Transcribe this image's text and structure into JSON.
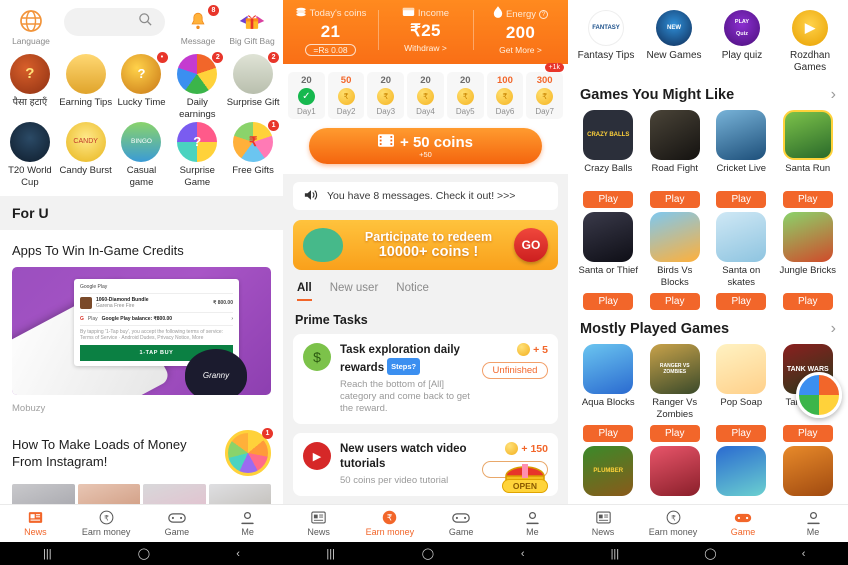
{
  "panel1": {
    "topbar": {
      "language_label": "Language",
      "language_icon": "globe-icon",
      "search_placeholder": "",
      "search_icon": "search-icon",
      "message_label": "Message",
      "message_icon": "bell-icon",
      "message_badge": "8",
      "gift_label": "Big Gift Bag",
      "gift_icon": "gift-box-icon"
    },
    "grid": [
      {
        "label": "पैसा हटाएँ",
        "icon": "money-bag-icon",
        "badge": ""
      },
      {
        "label": "Earning Tips",
        "icon": "coin-stack-icon",
        "badge": ""
      },
      {
        "label": "Lucky Time",
        "icon": "mystery-gift-icon",
        "badge": "•"
      },
      {
        "label": "Daily earnings",
        "icon": "spin-wheel-icon",
        "badge": "2"
      },
      {
        "label": "Surprise Gift",
        "icon": "cash-pile-icon",
        "badge": "2"
      },
      {
        "label": "T20 World Cup",
        "icon": "cricket-icon",
        "badge": ""
      },
      {
        "label": "Candy Burst",
        "icon": "candy-icon",
        "badge": ""
      },
      {
        "label": "Casual game",
        "icon": "bingo-icon",
        "badge": ""
      },
      {
        "label": "Surprise Game",
        "icon": "question-wheel-icon",
        "badge": ""
      },
      {
        "label": "Free Gifts",
        "icon": "rupee-wheel-icon",
        "badge": "1"
      }
    ],
    "section_title": "For U",
    "article1": {
      "title": "Apps To Win In-Game Credits",
      "source": "Mobuzy",
      "card": {
        "store": "Google Play",
        "item_title": "1060-Diamond Bundle",
        "item_sub": "Garena Free Fire",
        "item_price": "₹ 800.00",
        "balance_label": "Google Play balance: ₹800.00",
        "terms": "By tapping '1-Tap buy', you accept the following terms of service: Terms of Service · Android Dudes, Privacy Notice, More",
        "buy_label": "1-TAP BUY",
        "brand": "Granny"
      }
    },
    "article2": {
      "title": "How To Make Loads of Money From Instagram!",
      "badge": "1"
    },
    "bottom_nav": [
      {
        "label": "News",
        "icon": "news-icon",
        "active": true
      },
      {
        "label": "Earn money",
        "icon": "rupee-circle-icon",
        "active": false
      },
      {
        "label": "Game",
        "icon": "gamepad-icon",
        "active": false
      },
      {
        "label": "Me",
        "icon": "person-icon",
        "active": false
      }
    ]
  },
  "panel2": {
    "wallet": [
      {
        "label": "Today's coins",
        "icon": "coins-icon",
        "value": "21",
        "sub": "=Rs 0.08",
        "sub_style": "pill"
      },
      {
        "label": "Income",
        "icon": "wallet-icon",
        "value": "₹25",
        "sub": "Withdraw >",
        "sub_style": "link"
      },
      {
        "label": "Energy",
        "icon": "flame-icon",
        "value": "200",
        "sub": "Get More >",
        "sub_style": "link",
        "help": "?"
      }
    ],
    "checkin": [
      {
        "amount": "20",
        "day": "Day1",
        "state": "done"
      },
      {
        "amount": "50",
        "day": "Day2",
        "state": "hot"
      },
      {
        "amount": "20",
        "day": "Day3",
        "state": "normal"
      },
      {
        "amount": "20",
        "day": "Day4",
        "state": "normal"
      },
      {
        "amount": "20",
        "day": "Day5",
        "state": "normal"
      },
      {
        "amount": "100",
        "day": "Day6",
        "state": "hot"
      },
      {
        "amount": "300",
        "day": "Day7",
        "state": "hot",
        "badge": "+1k"
      }
    ],
    "cta": {
      "label": "+ 50 coins",
      "sub": "+50",
      "icon": "video-icon"
    },
    "message_bar": {
      "text": "You have 8 messages. Check it out! >>>",
      "icon": "speaker-icon"
    },
    "promo": {
      "line1": "Participate to redeem",
      "line2": "10000+ coins !",
      "button": "GO",
      "icon": "money-sack-icon"
    },
    "tabs": [
      {
        "label": "All",
        "active": true
      },
      {
        "label": "New user",
        "active": false
      },
      {
        "label": "Notice",
        "active": false
      }
    ],
    "prime_header": "Prime Tasks",
    "tasks": [
      {
        "title": "Task exploration daily rewards",
        "badge": "Steps?",
        "desc": "Reach the bottom of [All] category and come back to get the reward.",
        "reward": "+ 5",
        "status": "Unfinished",
        "icon": "money-bag-icon"
      },
      {
        "title": "New users watch video tutorials",
        "badge": "",
        "desc": "50 coins per video tutorial",
        "reward": "+ 150",
        "status": "",
        "open_label": "OPEN",
        "icon": "play-icon"
      }
    ],
    "bottom_nav": [
      {
        "label": "News",
        "icon": "news-icon",
        "active": false
      },
      {
        "label": "Earn money",
        "icon": "rupee-circle-icon",
        "active": true
      },
      {
        "label": "Game",
        "icon": "gamepad-icon",
        "active": false
      },
      {
        "label": "Me",
        "icon": "person-icon",
        "active": false
      }
    ]
  },
  "panel3": {
    "shortcuts": [
      {
        "label": "Fantasy Tips",
        "icon": "fantasy-sports-icon"
      },
      {
        "label": "New Games",
        "icon": "new-games-icon"
      },
      {
        "label": "Play quiz",
        "icon": "play-quiz-icon"
      },
      {
        "label": "Rozdhan Games",
        "icon": "rozdhan-games-icon"
      }
    ],
    "section1": {
      "title": "Games You Might Like",
      "chevron": "›",
      "games": [
        {
          "name": "Crazy Balls",
          "play": "Play",
          "art": "crazy-balls",
          "thumb_text": "CRAZY BALLS"
        },
        {
          "name": "Road Fight",
          "play": "Play",
          "art": "road-fight",
          "thumb_text": ""
        },
        {
          "name": "Cricket Live",
          "play": "Play",
          "art": "cricket-live",
          "thumb_text": ""
        },
        {
          "name": "Santa Run",
          "play": "Play",
          "art": "santa-run",
          "thumb_text": ""
        },
        {
          "name": "Santa or Thief",
          "play": "Play",
          "art": "santa-thief",
          "thumb_text": ""
        },
        {
          "name": "Birds Vs Blocks",
          "play": "Play",
          "art": "birds-blocks",
          "thumb_text": ""
        },
        {
          "name": "Santa on skates",
          "play": "Play",
          "art": "santa-skates",
          "thumb_text": ""
        },
        {
          "name": "Jungle Bricks",
          "play": "Play",
          "art": "jungle-bricks",
          "thumb_text": ""
        }
      ]
    },
    "section2": {
      "title": "Mostly Played Games",
      "chevron": "›",
      "games": [
        {
          "name": "Aqua Blocks",
          "play": "Play",
          "art": "aqua-blocks",
          "thumb_text": ""
        },
        {
          "name": "Ranger Vs Zombies",
          "play": "Play",
          "art": "ranger-zombies",
          "thumb_text": "RANGER VS ZOMBIES"
        },
        {
          "name": "Pop Soap",
          "play": "Play",
          "art": "pop-soap",
          "thumb_text": ""
        },
        {
          "name": "Tank Wars",
          "play": "Play",
          "art": "tank-wars",
          "thumb_text": "TANK WARS"
        },
        {
          "name": "",
          "play": "",
          "art": "plumber",
          "thumb_text": "PLUMBER"
        },
        {
          "name": "",
          "play": "",
          "art": "slice",
          "thumb_text": ""
        },
        {
          "name": "",
          "play": "",
          "art": "blue-game",
          "thumb_text": ""
        },
        {
          "name": "",
          "play": "",
          "art": "basketball",
          "thumb_text": ""
        }
      ]
    },
    "bottom_nav": [
      {
        "label": "News",
        "icon": "news-icon",
        "active": false
      },
      {
        "label": "Earn money",
        "icon": "rupee-circle-icon",
        "active": false
      },
      {
        "label": "Game",
        "icon": "gamepad-icon",
        "active": true
      },
      {
        "label": "Me",
        "icon": "person-icon",
        "active": false
      }
    ]
  },
  "colors": {
    "accent": "#f2662a",
    "wallet_bg": "#f9781a",
    "badge_red": "#e8352a",
    "coin_gold": "#f5b423",
    "bg_grey": "#f2f2f2"
  }
}
